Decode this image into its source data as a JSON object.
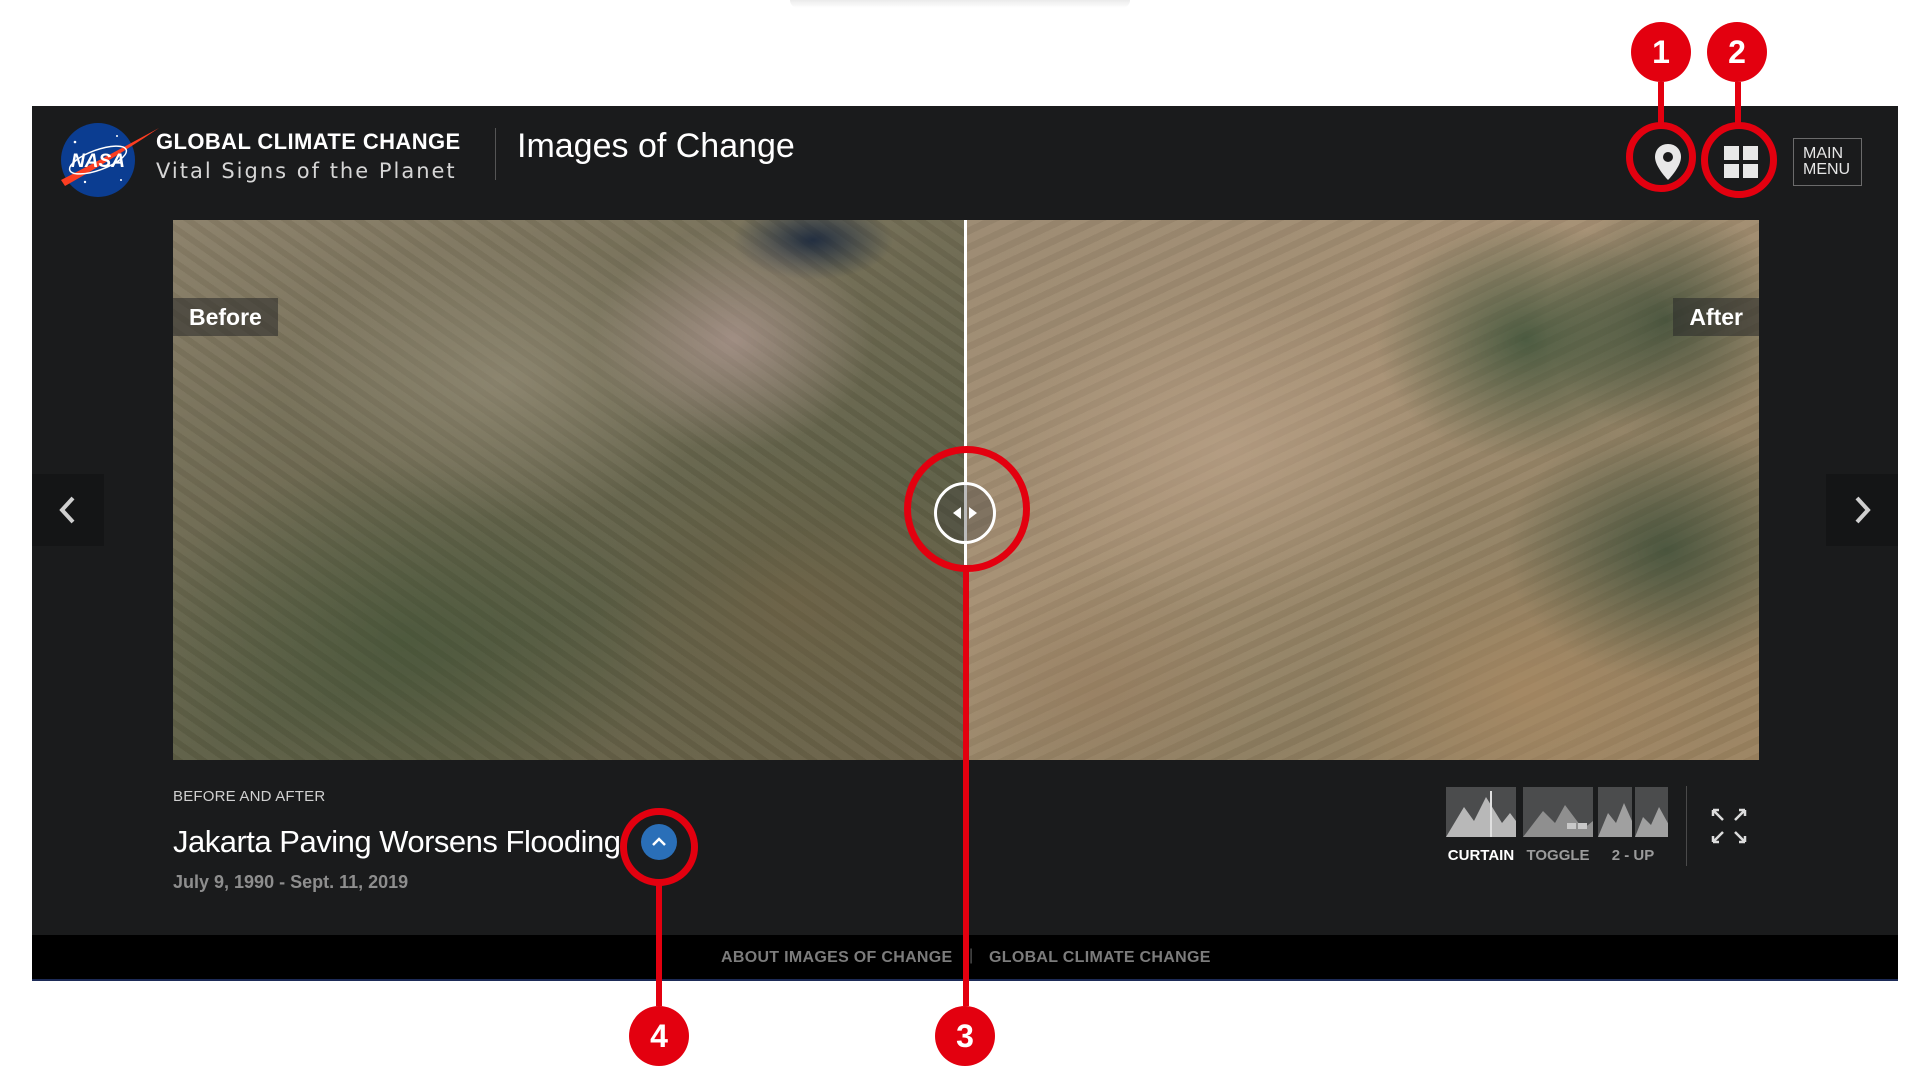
{
  "header": {
    "brand_title": "GLOBAL CLIMATE CHANGE",
    "brand_subtitle": "Vital Signs of the Planet",
    "logo_text": "NASA",
    "page_title": "Images of Change",
    "main_menu_line1": "MAIN",
    "main_menu_line2": "MENU",
    "location_icon": "map-pin-icon",
    "grid_icon": "grid-icon"
  },
  "viewer": {
    "before_label": "Before",
    "after_label": "After",
    "prev_icon": "chevron-left-icon",
    "next_icon": "chevron-right-icon",
    "slider_icon": "left-right-arrows-icon"
  },
  "caption": {
    "kicker": "BEFORE AND AFTER",
    "title": "Jakarta Paving Worsens Flooding",
    "date_range": "July 9, 1990 - Sept. 11, 2019",
    "expand_icon": "chevron-up-icon"
  },
  "view_modes": [
    {
      "label": "CURTAIN",
      "active": true
    },
    {
      "label": "TOGGLE",
      "active": false
    },
    {
      "label": "2 - UP",
      "active": false
    }
  ],
  "fullscreen_icon": "fullscreen-icon",
  "footer": {
    "link1": "ABOUT IMAGES OF CHANGE",
    "separator": "|",
    "link2": "GLOBAL CLIMATE CHANGE"
  },
  "annotations": [
    "1",
    "2",
    "3",
    "4"
  ],
  "colors": {
    "annotation_red": "#e3000f",
    "background_dark": "#1a1b1c",
    "accent_blue": "#2a6fb8"
  }
}
